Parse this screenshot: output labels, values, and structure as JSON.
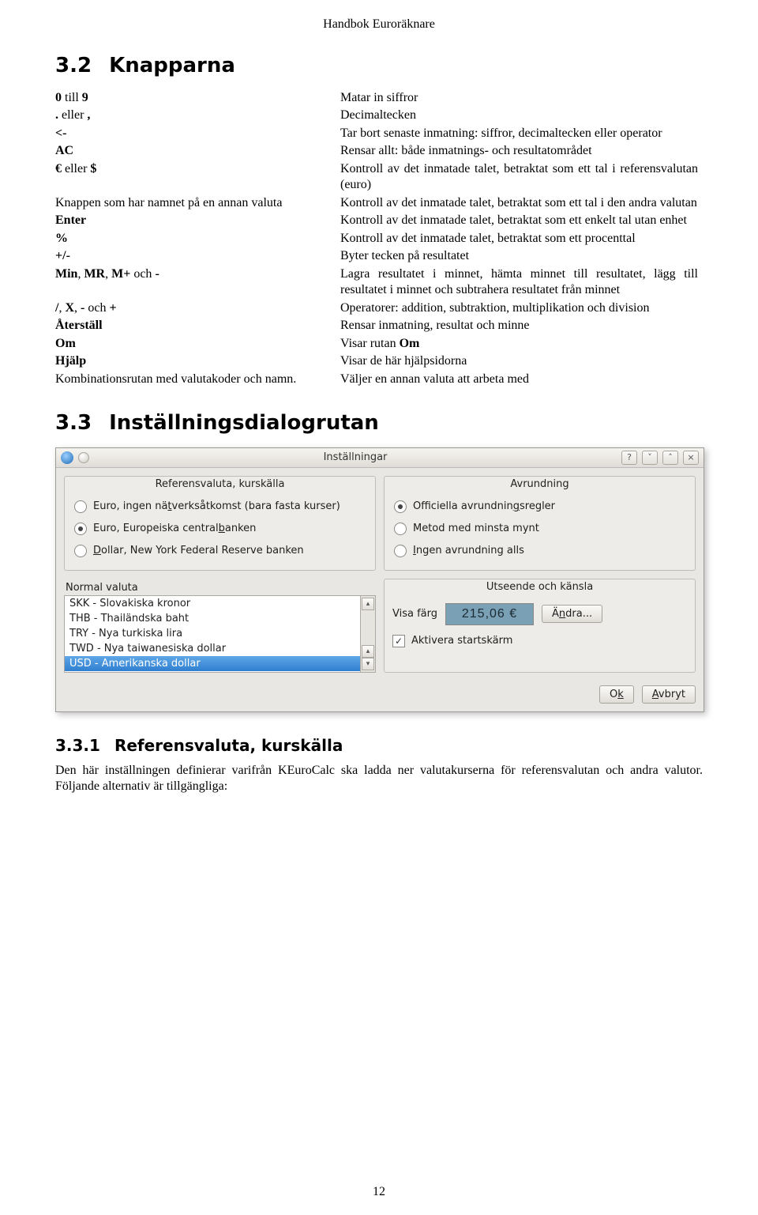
{
  "running_head": "Handbok Euroräknare",
  "sec32": {
    "num": "3.2",
    "title": "Knapparna"
  },
  "rows": [
    {
      "k_pre_b": "0",
      "k_mid": " till ",
      "k_post_b": "9",
      "v": "Matar in siffror"
    },
    {
      "k_pre_b": ".",
      "k_mid": " eller ",
      "k_post_b": ",",
      "v": "Decimaltecken"
    },
    {
      "k_pre_b": "<-",
      "k_mid": "",
      "k_post_b": "",
      "v": "Tar bort senaste inmatning: siffror, decimaltecken eller operator"
    },
    {
      "k_pre_b": "AC",
      "k_mid": "",
      "k_post_b": "",
      "v": "Rensar allt: både inmatnings- och resultatområdet"
    },
    {
      "k_pre_b": "€",
      "k_mid": " eller ",
      "k_post_b": "$",
      "v": "Kontroll av det inmatade talet, betraktat som ett tal i referensvalutan (euro)"
    },
    {
      "k_plain": "Knappen som har namnet på en annan valuta",
      "v": "Kontroll av det inmatade talet, betraktat som ett tal i den andra valutan"
    },
    {
      "k_pre_b": "Enter",
      "k_mid": "",
      "k_post_b": "",
      "v": "Kontroll av det inmatade talet, betraktat som ett enkelt tal utan enhet"
    },
    {
      "k_pre_b": "%",
      "k_mid": "",
      "k_post_b": "",
      "v": "Kontroll av det inmatade talet, betraktat som ett procenttal"
    },
    {
      "k_pre_b": "+/-",
      "k_mid": "",
      "k_post_b": "",
      "v": "Byter tecken på resultatet"
    },
    {
      "k_quad": [
        "Min",
        "MR",
        "M+",
        "-"
      ],
      "k_quad_sep": [
        ", ",
        ", ",
        " och "
      ],
      "v": "Lagra resultatet i minnet, hämta minnet till resultatet, lägg till resultatet i minnet och subtrahera resultatet från minnet"
    },
    {
      "k_quad": [
        "/",
        "X",
        "-",
        "+"
      ],
      "k_quad_sep": [
        ", ",
        ", ",
        " och "
      ],
      "v": "Operatorer: addition, subtraktion, multiplikation och division"
    },
    {
      "k_pre_b": "Återställ",
      "k_mid": "",
      "k_post_b": "",
      "v": "Rensar inmatning, resultat och minne"
    },
    {
      "k_pre_b": "Om",
      "k_mid": "",
      "k_post_b": "",
      "v_pre": "Visar rutan ",
      "v_b": "Om"
    },
    {
      "k_pre_b": "Hjälp",
      "k_mid": "",
      "k_post_b": "",
      "v": "Visar de här hjälpsidorna"
    },
    {
      "k_plain": "Kombinationsrutan med valutakoder och namn.",
      "v": "Väljer en annan valuta att arbeta med"
    }
  ],
  "sec33": {
    "num": "3.3",
    "title": "Inställningsdialogrutan"
  },
  "dialog": {
    "title": "Inställningar",
    "group_ref": {
      "legend": "Referensvaluta, kurskälla",
      "opt1_pre": "Euro, ingen nä",
      "opt1_u": "t",
      "opt1_post": "verksåtkomst (bara fasta kurser)",
      "opt2_pre": "Euro, Europeiska central",
      "opt2_u": "b",
      "opt2_post": "anken",
      "opt3_u": "D",
      "opt3_post": "ollar, New York Federal Reserve banken",
      "selected": 1
    },
    "normal_label": "Normal valuta",
    "list": [
      "SKK - Slovakiska kronor",
      "THB - Thailändska baht",
      "TRY - Nya turkiska lira",
      "TWD - Nya taiwanesiska dollar",
      "USD - Amerikanska dollar"
    ],
    "list_selected": 4,
    "group_round": {
      "legend": "Avrundning",
      "opt1_pre": "Officiella avrundnin",
      "opt1_u": "g",
      "opt1_post": "sregler",
      "opt2": "Metod med minsta mynt",
      "opt3_u": "I",
      "opt3_post": "ngen avrundning alls",
      "selected": 0
    },
    "group_lnf": {
      "legend": "Utseende och känsla",
      "color_label": "Visa färg",
      "swatch_text": "215,06 €",
      "change_pre": "Ä",
      "change_u": "n",
      "change_post": "dra...",
      "check_label": "Aktivera startskärm",
      "checked": true
    },
    "ok_pre": "O",
    "ok_u": "k",
    "cancel_u": "A",
    "cancel_post": "vbryt"
  },
  "sec331": {
    "num": "3.3.1",
    "title": "Referensvaluta, kurskälla"
  },
  "para331": "Den här inställningen definierar varifrån KEuroCalc ska ladda ner valutakurserna för referensvalutan och andra valutor. Följande alternativ är tillgängliga:",
  "page_number": "12"
}
